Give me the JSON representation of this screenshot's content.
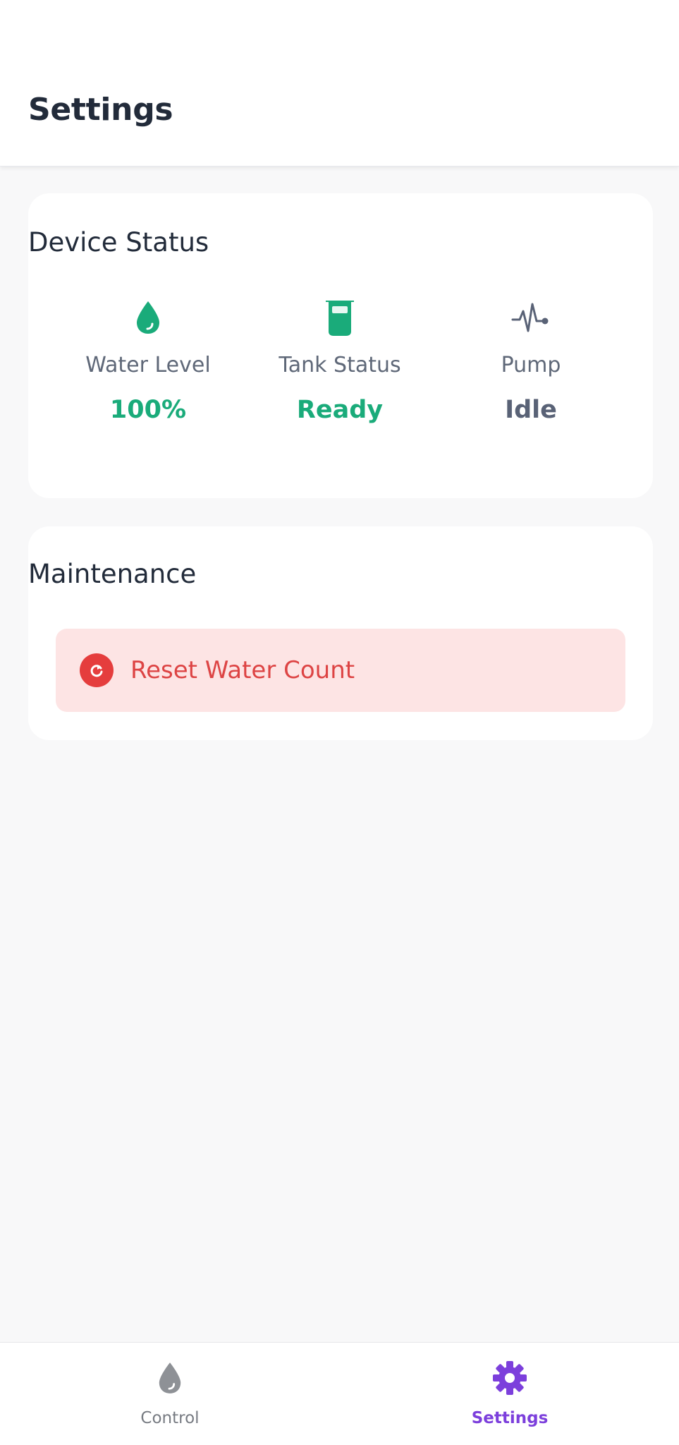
{
  "header": {
    "title": "Settings"
  },
  "device_status": {
    "title": "Device Status",
    "stats": [
      {
        "icon": "water-drop-icon",
        "label": "Water Level",
        "value": "100%",
        "color": "#1aab7a"
      },
      {
        "icon": "beaker-icon",
        "label": "Tank Status",
        "value": "Ready",
        "color": "#1aab7a"
      },
      {
        "icon": "pulse-icon",
        "label": "Pump",
        "value": "Idle",
        "color": "#596276"
      }
    ]
  },
  "maintenance": {
    "title": "Maintenance",
    "reset_button": {
      "icon": "refresh-icon",
      "label": "Reset Water Count",
      "color": "#dd4444"
    }
  },
  "bottom_nav": {
    "items": [
      {
        "icon": "water-drop-icon",
        "label": "Control",
        "active": false
      },
      {
        "icon": "gear-icon",
        "label": "Settings",
        "active": true,
        "color": "#7c3fdc"
      }
    ]
  }
}
